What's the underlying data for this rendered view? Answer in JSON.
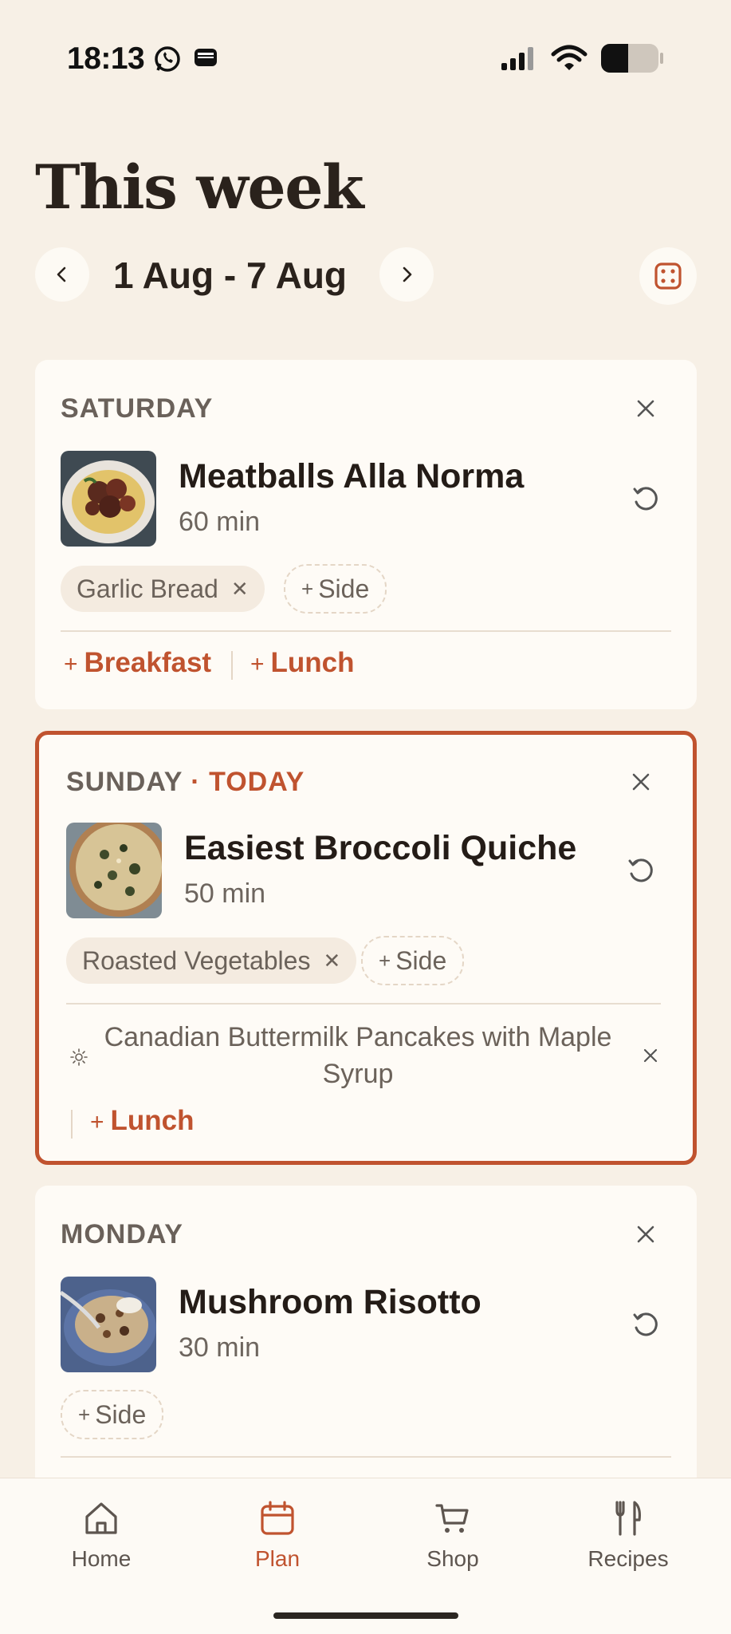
{
  "status": {
    "time": "18:13"
  },
  "header": {
    "title": "This week",
    "week_range": "1 Aug - 7 Aug"
  },
  "days": [
    {
      "label": "SATURDAY",
      "recipe": {
        "title": "Meatballs Alla Norma",
        "time": "60 min"
      },
      "sides": [
        {
          "label": "Garlic Bread"
        }
      ],
      "add_side": "Side",
      "add_meals": [
        "Breakfast",
        "Lunch"
      ]
    },
    {
      "label": "SUNDAY",
      "today": "· TODAY",
      "recipe": {
        "title": "Easiest Broccoli Quiche",
        "time": "50 min"
      },
      "sides": [
        {
          "label": "Roasted Vegetables"
        }
      ],
      "add_side": "Side",
      "breakfast": "Canadian Buttermilk Pancakes with Maple Syrup",
      "add_meals": [
        "Lunch"
      ]
    },
    {
      "label": "MONDAY",
      "recipe": {
        "title": "Mushroom Risotto",
        "time": "30 min"
      },
      "add_side": "Side"
    }
  ],
  "tabs": [
    {
      "label": "Home",
      "icon": "home-icon"
    },
    {
      "label": "Plan",
      "icon": "calendar-icon",
      "active": true
    },
    {
      "label": "Shop",
      "icon": "cart-icon"
    },
    {
      "label": "Recipes",
      "icon": "fork-knife-icon"
    }
  ],
  "colors": {
    "accent": "#c0532f",
    "background": "#f7f0e6",
    "card": "#fefbf6"
  }
}
